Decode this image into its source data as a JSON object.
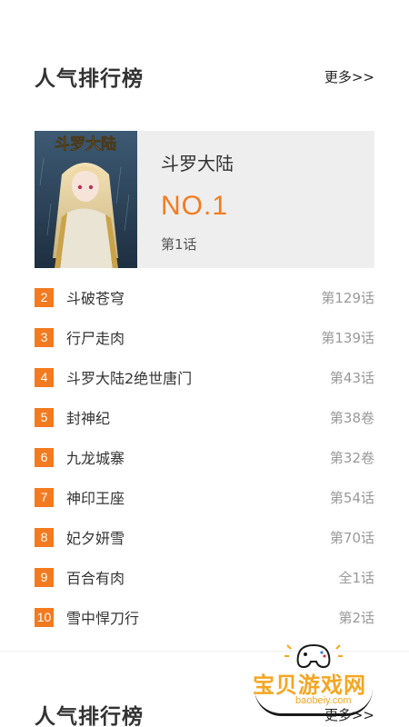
{
  "sections": [
    {
      "title": "人气排行榜",
      "more": "更多>>"
    },
    {
      "title": "人气排行榜",
      "more": "更多>>"
    }
  ],
  "top": {
    "title": "斗罗大陆",
    "rank": "NO.1",
    "episode": "第1话",
    "cover_title": "斗罗大陆"
  },
  "list": [
    {
      "num": "2",
      "name": "斗破苍穹",
      "episode": "第129话"
    },
    {
      "num": "3",
      "name": "行尸走肉",
      "episode": "第139话"
    },
    {
      "num": "4",
      "name": "斗罗大陆2绝世唐门",
      "episode": "第43话"
    },
    {
      "num": "5",
      "name": "封神纪",
      "episode": "第38卷"
    },
    {
      "num": "6",
      "name": "九龙城寨",
      "episode": "第32卷"
    },
    {
      "num": "7",
      "name": "神印王座",
      "episode": "第54话"
    },
    {
      "num": "8",
      "name": "妃夕妍雪",
      "episode": "第70话"
    },
    {
      "num": "9",
      "name": "百合有肉",
      "episode": "全1话"
    },
    {
      "num": "10",
      "name": "雪中悍刀行",
      "episode": "第2话"
    }
  ],
  "watermark": {
    "text": "宝贝游戏网",
    "url": "baobeiy.com"
  },
  "colors": {
    "accent": "#f47a1f",
    "card_bg": "#eeeeee"
  }
}
